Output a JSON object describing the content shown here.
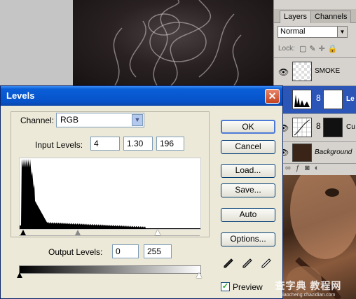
{
  "layers_panel": {
    "tabs": [
      "Layers",
      "Channels"
    ],
    "blend_mode": "Normal",
    "lock_label": "Lock:",
    "layers": [
      {
        "name": "SMOKE",
        "visible": true,
        "selected": false
      },
      {
        "name": "Le",
        "visible": true,
        "selected": true
      },
      {
        "name": "Cu",
        "visible": true,
        "selected": false
      },
      {
        "name": "Background",
        "visible": true,
        "selected": false
      }
    ],
    "link_icon": "8"
  },
  "dialog": {
    "title": "Levels",
    "close_glyph": "✕",
    "channel_label": "Channel:",
    "channel_value": "RGB",
    "input_label": "Input Levels:",
    "input_values": [
      "4",
      "1.30",
      "196"
    ],
    "output_label": "Output Levels:",
    "output_values": [
      "0",
      "255"
    ],
    "buttons": {
      "ok": "OK",
      "cancel": "Cancel",
      "load": "Load...",
      "save": "Save...",
      "auto": "Auto",
      "options": "Options..."
    },
    "preview_label": "Preview",
    "preview_checked": true
  },
  "watermark": {
    "line1": "查字典 教程网",
    "line2": "jiaocheng.chazidian.com"
  },
  "colors": {
    "titlebar": "#0752c9",
    "selected_layer": "#2c55b8",
    "dialog_bg": "#ece9d8"
  }
}
